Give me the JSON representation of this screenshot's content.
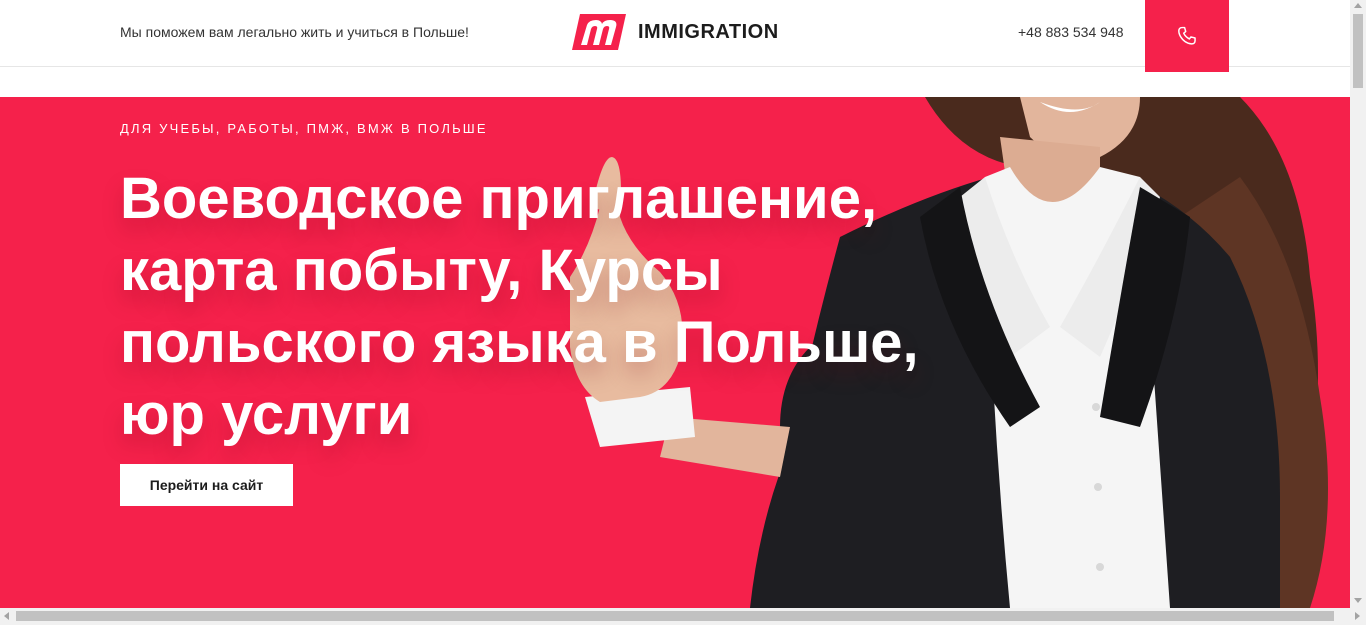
{
  "header": {
    "tagline": "Мы поможем вам легально жить и учиться в Польше!",
    "logo_text": "IMMIGRATION",
    "phone": "+48 883 534 948",
    "call_icon": "phone-icon"
  },
  "hero": {
    "eyebrow": "ДЛЯ УЧЕБЫ, РАБОТЫ, ПМЖ, ВМЖ В ПОЛЬШЕ",
    "title": "Воеводское приглашение, карта побыту, Курсы польского языка в Польше, юр услуги",
    "button_label": "Перейти на сайт"
  },
  "colors": {
    "accent": "#f5214b",
    "text_dark": "#1c1c1c",
    "white": "#ffffff"
  }
}
